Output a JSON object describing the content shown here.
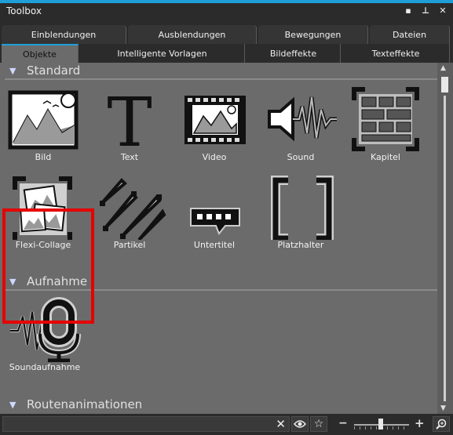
{
  "window": {
    "title": "Toolbox"
  },
  "tabs": {
    "row1": [
      "Einblendungen",
      "Ausblendungen",
      "Bewegungen",
      "Dateien"
    ],
    "row2": [
      "Objekte",
      "Intelligente Vorlagen",
      "Bildeffekte",
      "Texteffekte"
    ],
    "active": "Objekte"
  },
  "sections": {
    "standard": {
      "title": "Standard",
      "items": [
        "Bild",
        "Text",
        "Video",
        "Sound",
        "Kapitel",
        "Flexi-Collage",
        "Partikel",
        "Untertitel",
        "Platzhalter"
      ]
    },
    "aufnahme": {
      "title": "Aufnahme",
      "items": [
        "Soundaufnahme"
      ]
    },
    "routen": {
      "title": "Routenanimationen"
    }
  },
  "search": {
    "value": "",
    "placeholder": ""
  },
  "colors": {
    "accent": "#1e9fd8",
    "highlight": "#e60000",
    "panel": "#6b6b6b",
    "chrome": "#2b2b2b"
  }
}
